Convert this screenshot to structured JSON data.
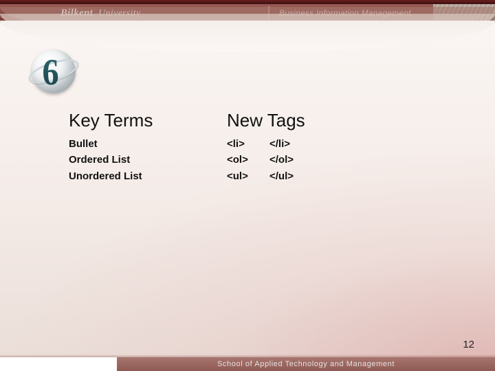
{
  "header": {
    "wordmark_name": "Bilkent",
    "wordmark_suffix": "University",
    "right_label": "Business Information Management"
  },
  "logo": {
    "glyph": "6"
  },
  "content": {
    "left_heading": "Key Terms",
    "right_heading": "New Tags",
    "rows": [
      {
        "term": "Bullet",
        "open": "<li>",
        "close": "</li>"
      },
      {
        "term": "Ordered List",
        "open": "<ol>",
        "close": "</ol>"
      },
      {
        "term": "Unordered List",
        "open": "<ul>",
        "close": "</ul>"
      }
    ]
  },
  "footer": {
    "text": "School of Applied Technology and Management"
  },
  "page_number": "12"
}
